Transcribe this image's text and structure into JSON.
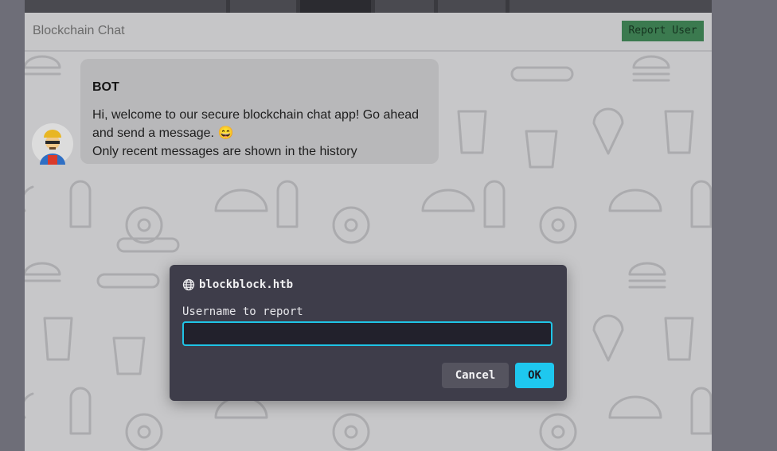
{
  "header": {
    "title": "Blockchain Chat",
    "report_label": "Report User"
  },
  "messages": [
    {
      "sender": "BOT",
      "lines": [
        "Hi, welcome to our secure blockchain chat app! Go ahead and send a message. 😄",
        "Only recent messages are shown in the history"
      ]
    }
  ],
  "dialog": {
    "origin": "blockblock.htb",
    "prompt_label": "Username to report",
    "input_value": "",
    "cancel_label": "Cancel",
    "ok_label": "OK"
  },
  "colors": {
    "accent": "#1ec8ef",
    "report_button": "#3b7a4f",
    "dialog_bg": "#3e3d4a"
  },
  "icons": {
    "dialog_origin": "globe-icon",
    "avatar": "bot-avatar-icon"
  }
}
